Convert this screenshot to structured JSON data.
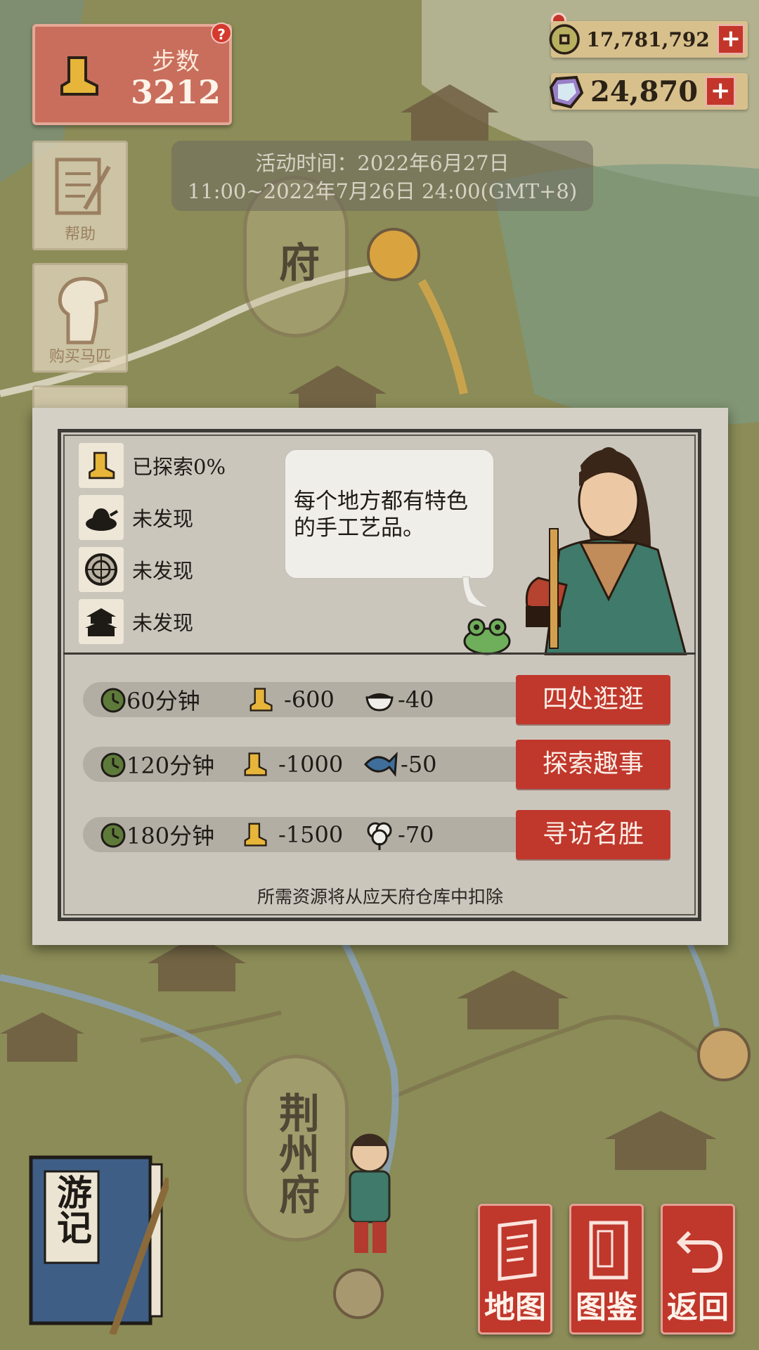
{
  "status_bar": {
    "steps_label": "步数",
    "steps_value": "3212",
    "help_glyph": "?"
  },
  "currency": {
    "coins": "17,781,792",
    "gems": "24,870",
    "plus_glyph": "+"
  },
  "event": {
    "line1": "活动时间：2022年6月27日",
    "line2": "11:00~2022年7月26日 24:00(GMT+8)"
  },
  "side_menu": [
    {
      "label": "帮助",
      "icon": "help-scroll-icon"
    },
    {
      "label": "购买马匹",
      "icon": "horse-icon"
    }
  ],
  "map": {
    "city_top": "应天府",
    "city_top_visible": "府",
    "city_bottom": "荆州府"
  },
  "dialog": {
    "stats": [
      {
        "icon": "boot-icon",
        "text": "已探索0%"
      },
      {
        "icon": "teapot-icon",
        "text": "未发现"
      },
      {
        "icon": "dish-icon",
        "text": "未发现"
      },
      {
        "icon": "building-icon",
        "text": "未发现"
      }
    ],
    "speech": "每个地方都有特色的手工艺品。",
    "actions": [
      {
        "time": "60分钟",
        "steps": "-600",
        "resource_icon": "rice-bowl-icon",
        "resource": "-40",
        "button": "四处逛逛"
      },
      {
        "time": "120分钟",
        "steps": "-1000",
        "resource_icon": "fish-icon",
        "resource": "-50",
        "button": "探索趣事"
      },
      {
        "time": "180分钟",
        "steps": "-1500",
        "resource_icon": "cotton-icon",
        "resource": "-70",
        "button": "寻访名胜"
      }
    ],
    "note": "所需资源将从应天府仓库中扣除"
  },
  "bottom": {
    "journal": "游记",
    "buttons": [
      "地图",
      "图鉴",
      "返回"
    ]
  },
  "colors": {
    "accent_red": "#c0372c",
    "steps_panel": "#c96e5c",
    "map_green": "#8a8a55"
  }
}
